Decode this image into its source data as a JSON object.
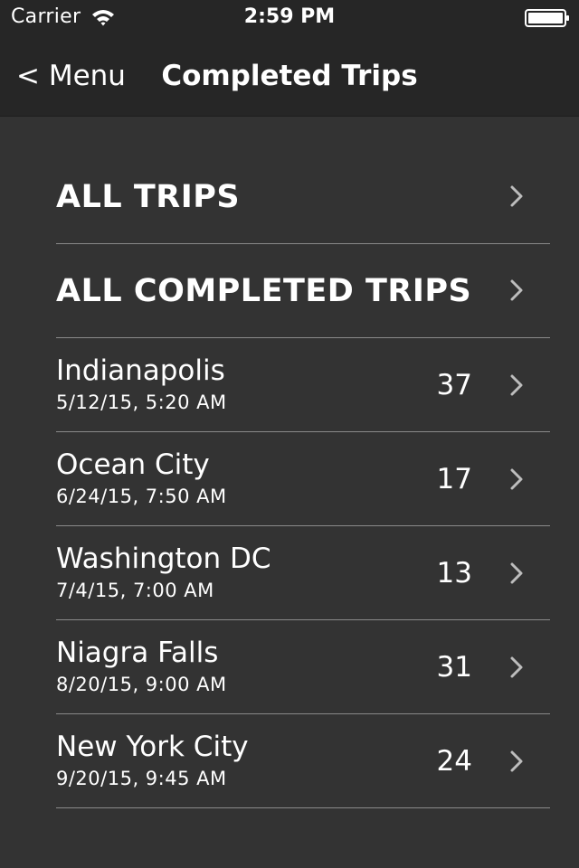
{
  "status_bar": {
    "carrier": "Carrier",
    "time": "2:59 PM",
    "wifi_icon": "wifi-icon",
    "battery_icon": "battery-icon"
  },
  "nav": {
    "back_label": "< Menu",
    "title": "Completed Trips"
  },
  "headers": [
    {
      "label": "ALL TRIPS"
    },
    {
      "label": "ALL COMPLETED TRIPS"
    }
  ],
  "trips": [
    {
      "name": "Indianapolis",
      "date": "5/12/15, 5:20 AM",
      "count": "37"
    },
    {
      "name": "Ocean City",
      "date": "6/24/15, 7:50 AM",
      "count": "17"
    },
    {
      "name": "Washington DC",
      "date": "7/4/15, 7:00 AM",
      "count": "13"
    },
    {
      "name": "Niagra Falls",
      "date": "8/20/15, 9:00 AM",
      "count": "31"
    },
    {
      "name": "New York City",
      "date": "9/20/15, 9:45 AM",
      "count": "24"
    }
  ],
  "colors": {
    "background": "#333333",
    "header_background": "#262626",
    "separator": "#8a8a8a",
    "text": "#ffffff",
    "chevron": "#bdbdbd"
  }
}
